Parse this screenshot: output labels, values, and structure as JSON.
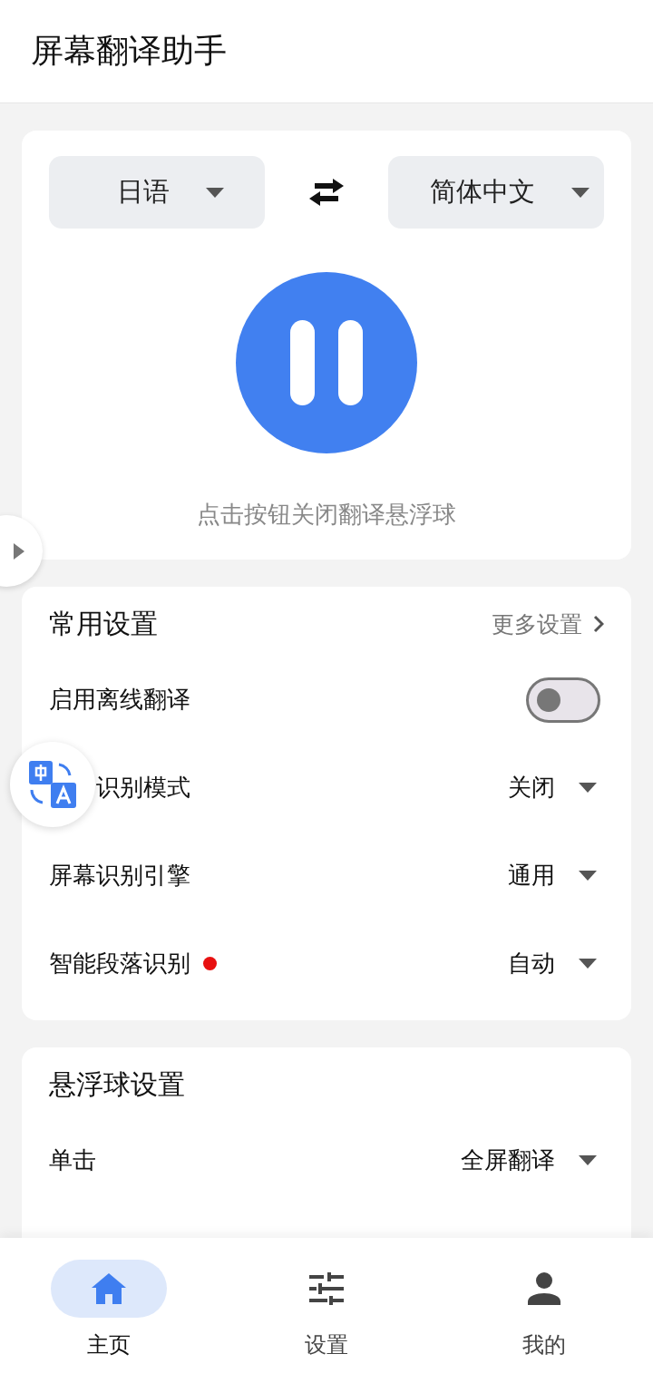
{
  "header": {
    "title": "屏幕翻译助手"
  },
  "languages": {
    "source": "日语",
    "target": "简体中文"
  },
  "translator": {
    "running": true,
    "hint": "点击按钮关闭翻译悬浮球"
  },
  "common_settings": {
    "title": "常用设置",
    "more": "更多设置",
    "items": [
      {
        "kind": "toggle",
        "label": "启用离线翻译",
        "on": false
      },
      {
        "kind": "select",
        "label": "识别模式",
        "value": "关闭",
        "covered": true
      },
      {
        "kind": "select",
        "label": "屏幕识别引擎",
        "value": "通用",
        "covered": false
      },
      {
        "kind": "select",
        "label": "智能段落识别",
        "value": "自动",
        "covered": false,
        "color": "#e81010"
      }
    ]
  },
  "ball_settings": {
    "title": "悬浮球设置",
    "items": [
      {
        "kind": "select",
        "label": "单击",
        "value": "全屏翻译",
        "covered": false
      }
    ]
  },
  "nav": [
    {
      "label": "主页",
      "selected": true
    },
    {
      "label": "设置",
      "selected": false
    },
    {
      "label": "我的",
      "selected": false
    }
  ]
}
